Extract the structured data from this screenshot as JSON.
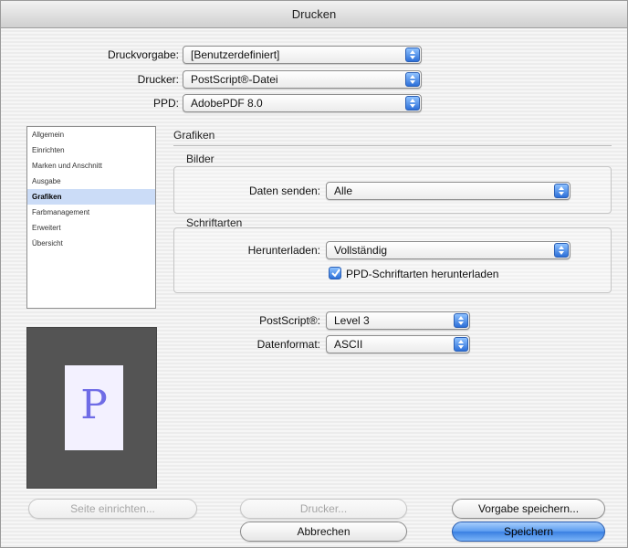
{
  "window": {
    "title": "Drucken"
  },
  "settings": {
    "druckvorgabe_label": "Druckvorgabe:",
    "druckvorgabe_value": "[Benutzerdefiniert]",
    "drucker_label": "Drucker:",
    "drucker_value": "PostScript®-Datei",
    "ppd_label": "PPD:",
    "ppd_value": "AdobePDF 8.0"
  },
  "sidebar": {
    "items": [
      {
        "label": "Allgemein"
      },
      {
        "label": "Einrichten"
      },
      {
        "label": "Marken und Anschnitt"
      },
      {
        "label": "Ausgabe"
      },
      {
        "label": "Grafiken"
      },
      {
        "label": "Farbmanagement"
      },
      {
        "label": "Erweitert"
      },
      {
        "label": "Übersicht"
      }
    ],
    "selected_index": 4
  },
  "preview": {
    "letter": "P"
  },
  "main": {
    "section_title": "Grafiken",
    "bilder": {
      "title": "Bilder",
      "daten_senden_label": "Daten senden:",
      "daten_senden_value": "Alle"
    },
    "schriftarten": {
      "title": "Schriftarten",
      "herunterladen_label": "Herunterladen:",
      "herunterladen_value": "Vollständig",
      "ppd_checkbox_label": "PPD-Schriftarten herunterladen",
      "ppd_checkbox_checked": true
    },
    "postscript_label": "PostScript®:",
    "postscript_value": "Level 3",
    "datenformat_label": "Datenformat:",
    "datenformat_value": "ASCII"
  },
  "buttons": {
    "seite_einrichten": "Seite einrichten...",
    "drucker": "Drucker...",
    "vorgabe_speichern": "Vorgabe speichern...",
    "abbrechen": "Abbrechen",
    "speichern": "Speichern"
  },
  "colors": {
    "accent": "#3a7fe2",
    "selection": "#cbdcf7",
    "preview_bg": "#545454",
    "preview_letter": "#6f6ce6"
  }
}
